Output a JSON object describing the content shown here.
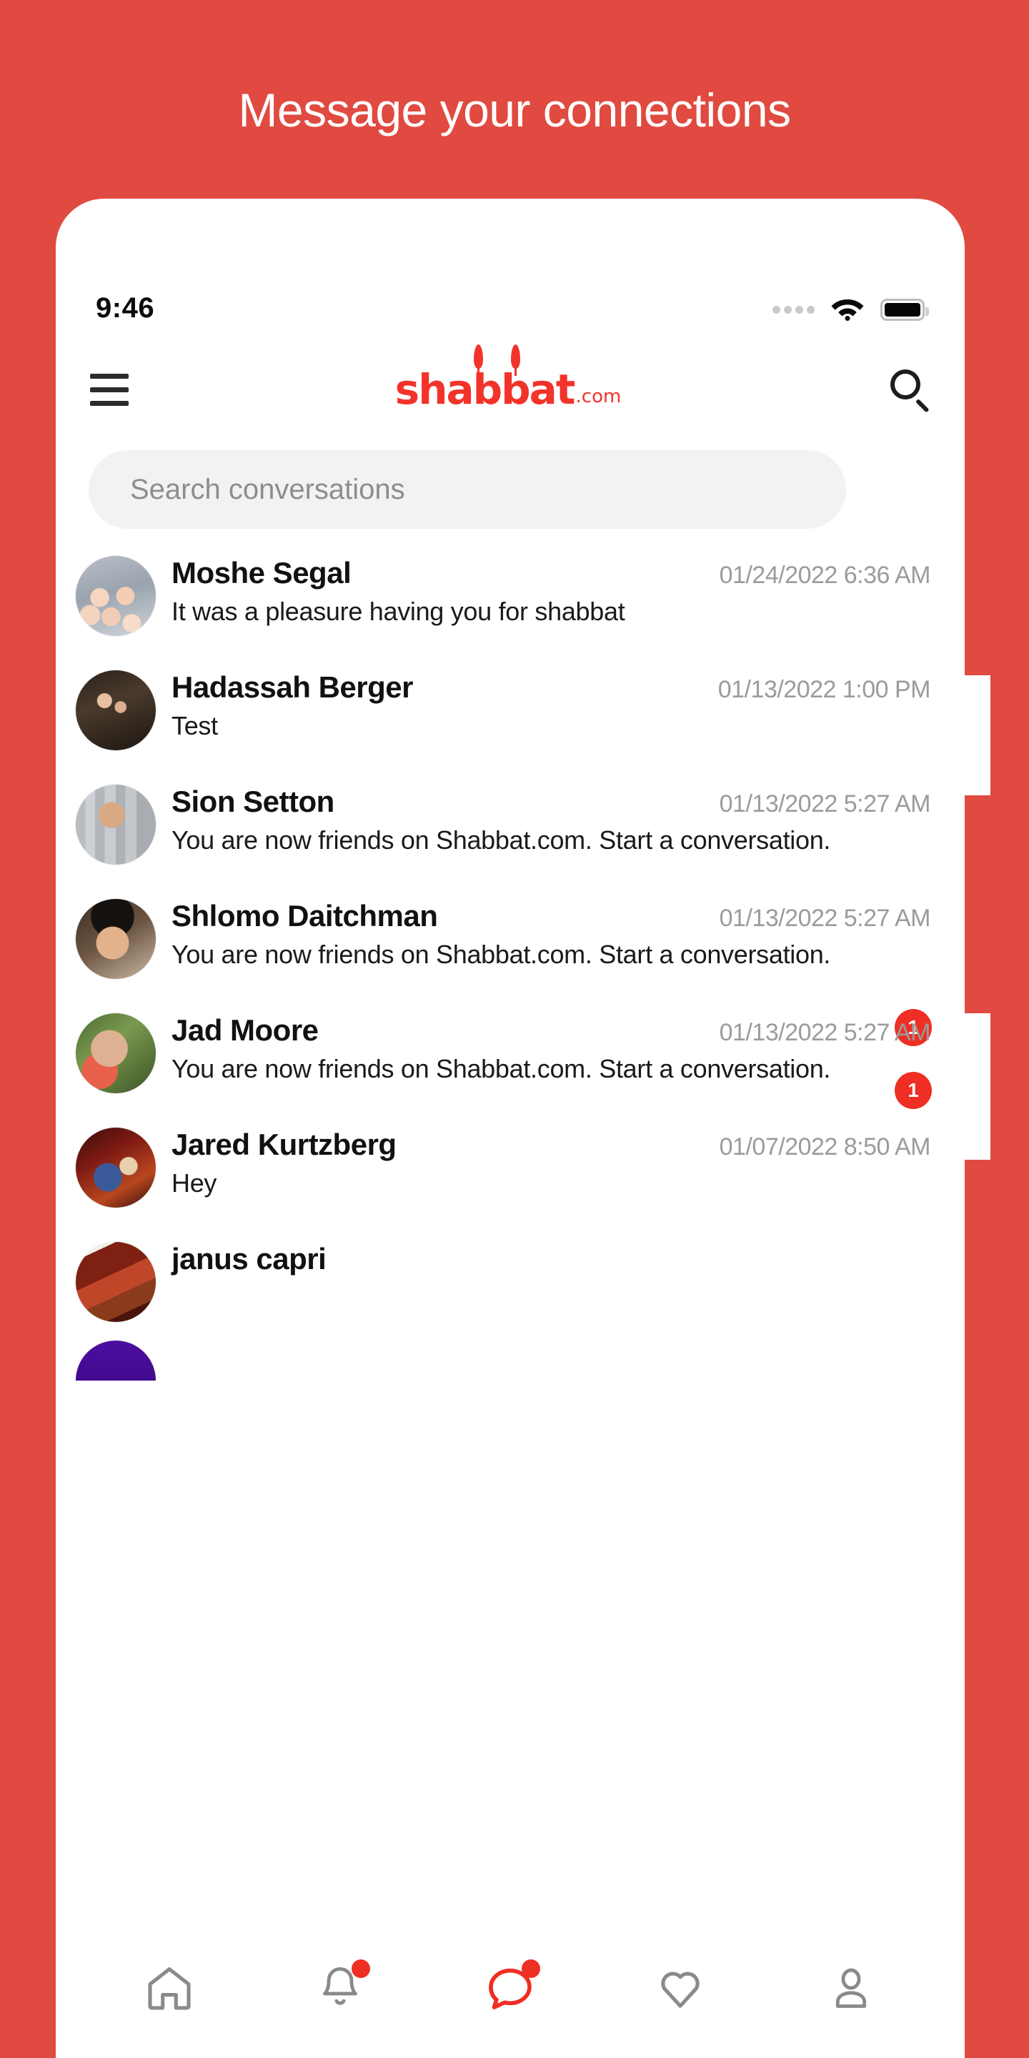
{
  "promo": {
    "title": "Message your connections"
  },
  "theme": {
    "brand_red": "#e04a40",
    "logo_red": "#f2332a",
    "badge_red": "#ef2e24",
    "muted_grey": "#9b9b9b"
  },
  "status_bar": {
    "time": "9:46",
    "signal_icon": "signal-dots-icon",
    "wifi_icon": "wifi-icon",
    "battery_icon": "battery-full-icon"
  },
  "appbar": {
    "menu_icon": "hamburger-menu-icon",
    "logo_word": "shabbat",
    "logo_suffix": ".com",
    "search_icon": "search-icon"
  },
  "search": {
    "placeholder": "Search conversations",
    "value": ""
  },
  "conversations": [
    {
      "name": "Moshe Segal",
      "time": "01/24/2022 6:36 AM",
      "preview": "It was a pleasure having you for shabbat",
      "unread": ""
    },
    {
      "name": "Hadassah Berger",
      "time": "01/13/2022 1:00 PM",
      "preview": "Test",
      "unread": ""
    },
    {
      "name": "Sion Setton",
      "time": "01/13/2022 5:27 AM",
      "preview": "You are now  friends on Shabbat.com. Start a conversation.",
      "unread": ""
    },
    {
      "name": "Shlomo Daitchman",
      "time": "01/13/2022 5:27 AM",
      "preview": "You are now  friends on Shabbat.com. Start a conversation.",
      "unread": "1"
    },
    {
      "name": "Jad Moore",
      "time": "01/13/2022 5:27 AM",
      "preview": "You are now  friends on Shabbat.com. Start a conversation.",
      "unread": "1"
    },
    {
      "name": "Jared Kurtzberg",
      "time": "01/07/2022 8:50 AM",
      "preview": "Hey",
      "unread": ""
    },
    {
      "name": "janus capri",
      "time": "",
      "preview": "",
      "unread": ""
    }
  ],
  "tabbar": {
    "items": [
      {
        "icon": "home-icon",
        "label": "Home",
        "active": false,
        "dot": false
      },
      {
        "icon": "bell-icon",
        "label": "Notifications",
        "active": false,
        "dot": true
      },
      {
        "icon": "chat-bubble-icon",
        "label": "Messages",
        "active": true,
        "dot": true
      },
      {
        "icon": "heart-icon",
        "label": "Favorites",
        "active": false,
        "dot": false
      },
      {
        "icon": "person-icon",
        "label": "Profile",
        "active": false,
        "dot": false
      }
    ]
  }
}
